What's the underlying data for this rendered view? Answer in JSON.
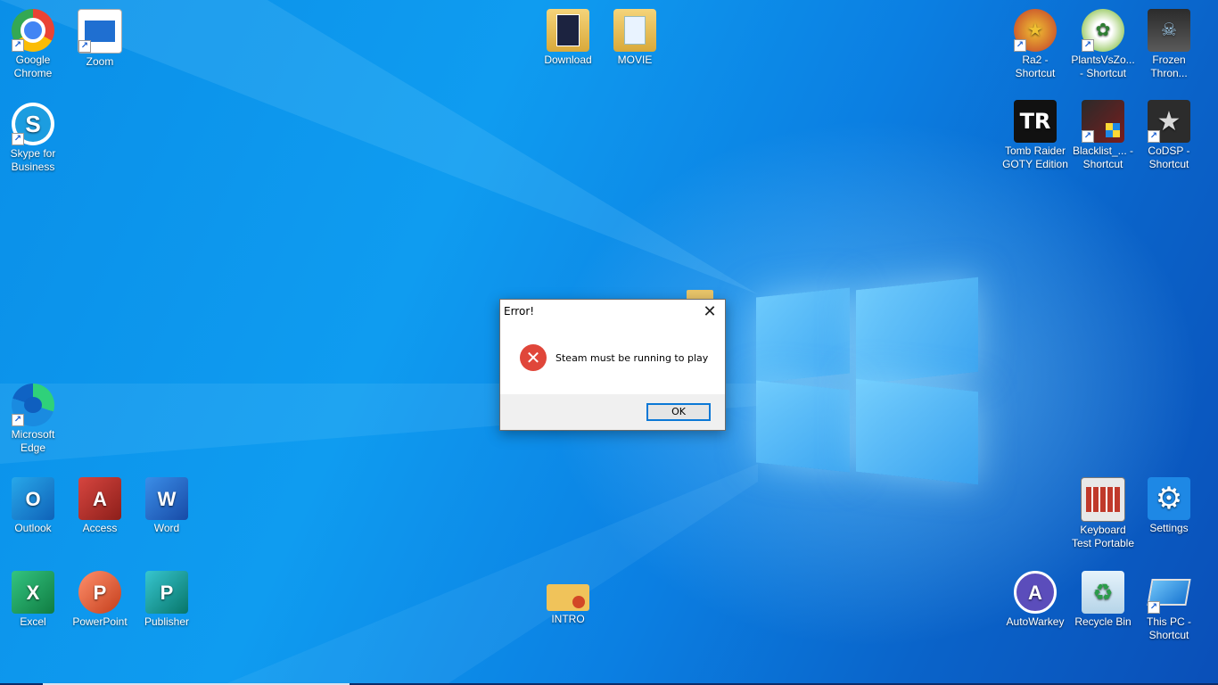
{
  "desktop": {
    "icons_left": [
      {
        "label": "Google Chrome",
        "name": "google-chrome"
      },
      {
        "label": "Zoom",
        "name": "zoom"
      },
      {
        "label": "Skype for Business",
        "name": "skype-for-business"
      },
      {
        "label": "Microsoft Edge",
        "name": "microsoft-edge"
      },
      {
        "label": "Outlook",
        "name": "outlook"
      },
      {
        "label": "Access",
        "name": "access"
      },
      {
        "label": "Word",
        "name": "word"
      },
      {
        "label": "Excel",
        "name": "excel"
      },
      {
        "label": "PowerPoint",
        "name": "powerpoint"
      },
      {
        "label": "Publisher",
        "name": "publisher"
      }
    ],
    "icons_center": [
      {
        "label": "Download",
        "name": "download"
      },
      {
        "label": "MOVIE",
        "name": "movie"
      },
      {
        "label": "INTRO",
        "name": "intro"
      }
    ],
    "icons_right": [
      {
        "label": "Ra2 - Shortcut",
        "name": "ra2-shortcut"
      },
      {
        "label": "PlantsVsZo... - Shortcut",
        "name": "plantsvszombies-shortcut"
      },
      {
        "label": "Frozen Thron...",
        "name": "frozen-throne"
      },
      {
        "label": "Tomb Raider GOTY Edition",
        "name": "tomb-raider"
      },
      {
        "label": "Blacklist_... - Shortcut",
        "name": "blacklist-shortcut"
      },
      {
        "label": "CoDSP - Shortcut",
        "name": "codsp-shortcut"
      },
      {
        "label": "Keyboard Test Portable",
        "name": "keyboard-test-portable"
      },
      {
        "label": "Settings",
        "name": "settings"
      },
      {
        "label": "AutoWarkey",
        "name": "autowarkey"
      },
      {
        "label": "Recycle Bin",
        "name": "recycle-bin"
      },
      {
        "label": "This PC - Shortcut",
        "name": "this-pc-shortcut"
      }
    ]
  },
  "dialog": {
    "title": "Error!",
    "close_glyph": "✕",
    "error_glyph": "✕",
    "message": "Steam must be running to play",
    "ok_label": "OK"
  },
  "icon_glyphs": {
    "zoom": "▭",
    "outlook": "O",
    "access": "A",
    "word": "W",
    "excel": "X",
    "powerpoint": "P",
    "publisher": "P",
    "tomb_raider": "TR",
    "autowarkey": "A",
    "settings": "⚙",
    "recycle": "♻"
  },
  "colors": {
    "desktop_blue": "#0b8ae6",
    "dialog_ok_border": "#0b78d6",
    "error_red": "#e0463a"
  }
}
